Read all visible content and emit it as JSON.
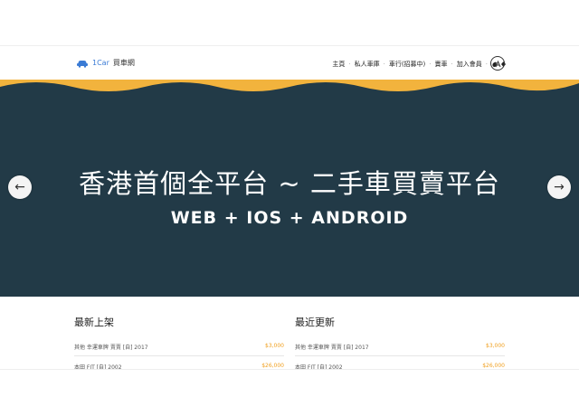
{
  "brand": {
    "name": "1Car",
    "cn": "買車網",
    "accent": "#3a7bd5"
  },
  "nav": {
    "items": [
      "主頁",
      "私人車庫",
      "車行(招募中)",
      "賣車",
      "加入會員"
    ],
    "os_icons": [
      "apple-icon",
      "android-icon"
    ],
    "user_icon": "user-icon"
  },
  "hero": {
    "title": "香港首個全平台 ~ 二手車買賣平台",
    "subtitle": "WEB + IOS + ANDROID",
    "bg_color": "#223a47",
    "scallop_color": "#f2b33d"
  },
  "latest": {
    "title": "最新上架",
    "rows": [
      {
        "name": "其他 幸運車牌 賣賣 [自] 2017",
        "price": "$3,000"
      },
      {
        "name": "本田 FIT [自] 2002",
        "price": "$26,000"
      }
    ]
  },
  "recent": {
    "title": "最近更新",
    "rows": [
      {
        "name": "其他 幸運車牌 賣賣 [自] 2017",
        "price": "$3,000"
      },
      {
        "name": "本田 FIT [自] 2002",
        "price": "$26,000"
      }
    ]
  }
}
